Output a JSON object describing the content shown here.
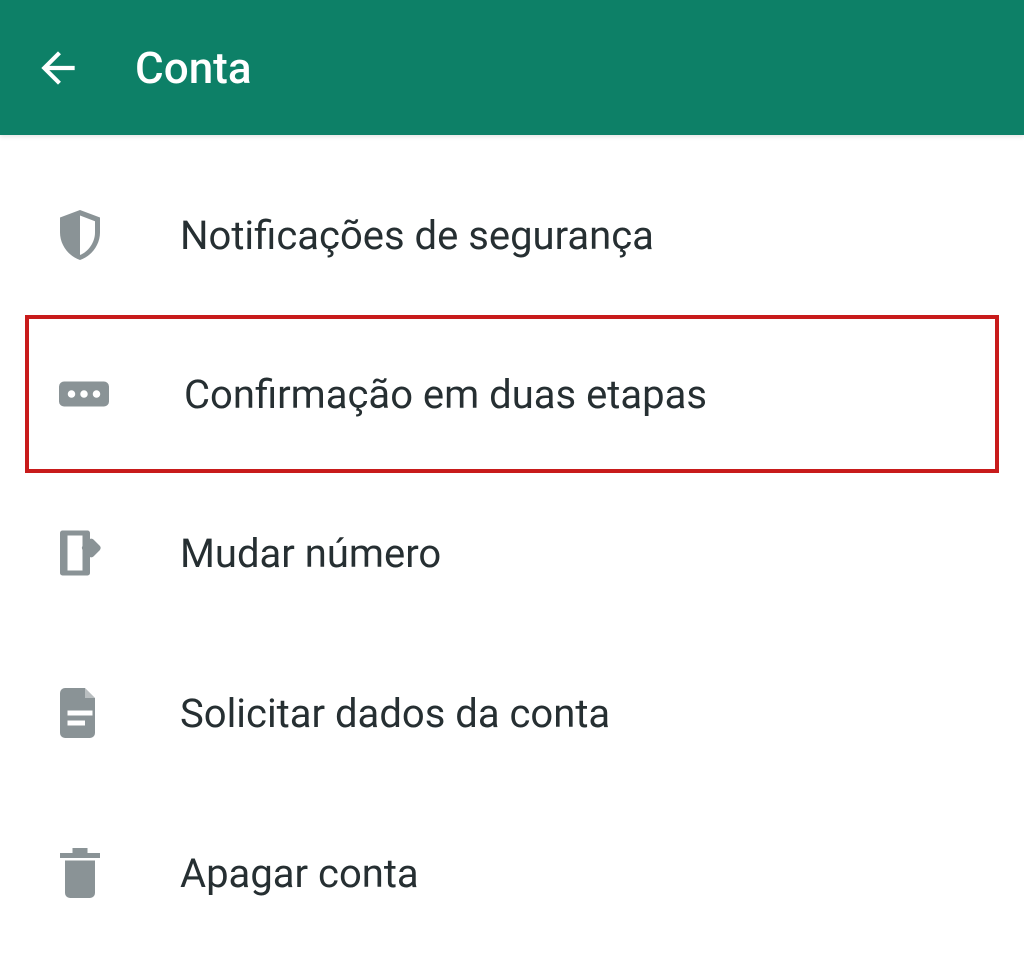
{
  "header": {
    "title": "Conta"
  },
  "menu": {
    "items": [
      {
        "label": "Notificações de segurança",
        "icon": "shield-icon",
        "highlighted": false
      },
      {
        "label": "Confirmação em duas etapas",
        "icon": "password-icon",
        "highlighted": true
      },
      {
        "label": "Mudar número",
        "icon": "phone-change-icon",
        "highlighted": false
      },
      {
        "label": "Solicitar dados da conta",
        "icon": "document-icon",
        "highlighted": false
      },
      {
        "label": "Apagar conta",
        "icon": "trash-icon",
        "highlighted": false
      }
    ]
  }
}
